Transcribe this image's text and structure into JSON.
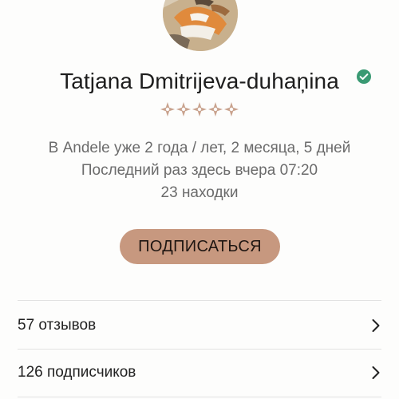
{
  "profile": {
    "name": "Tatjana Dmitrijeva-duhaņina",
    "verified_icon": "check-circle-icon",
    "rating_icon": "diamond-star-icon",
    "rating_stars": 5,
    "member_since": "В Andele уже 2 года / лет, 2 месяца, 5 дней",
    "last_seen": "Последний раз здесь вчера 07:20",
    "finds": "23 находки"
  },
  "actions": {
    "follow_label": "ПОДПИСАТЬСЯ"
  },
  "rows": [
    {
      "label": "57 отзывов",
      "icon": "chevron-right-icon"
    },
    {
      "label": "126 подписчиков",
      "icon": "chevron-right-icon"
    }
  ],
  "colors": {
    "accent": "#c7987f",
    "verified": "#3a9a73",
    "star": "#c9a38e",
    "muted_text": "#6b6b6b"
  }
}
